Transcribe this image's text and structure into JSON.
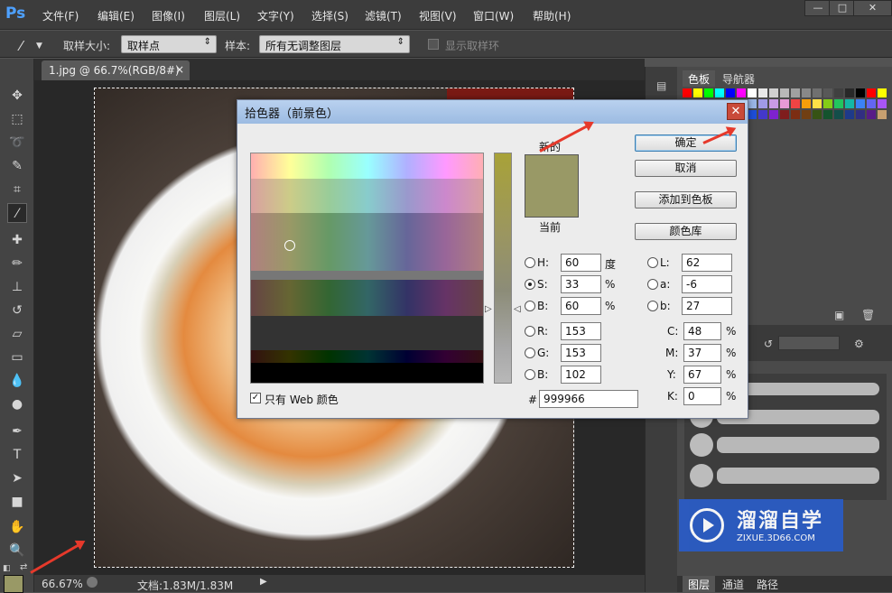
{
  "app": {
    "logo": "Ps"
  },
  "menu": [
    "文件(F)",
    "编辑(E)",
    "图像(I)",
    "图层(L)",
    "文字(Y)",
    "选择(S)",
    "滤镜(T)",
    "视图(V)",
    "窗口(W)",
    "帮助(H)"
  ],
  "options": {
    "sample_size_label": "取样大小:",
    "sample_size_value": "取样点",
    "sample_label": "样本:",
    "sample_value": "所有无调整图层",
    "show_ring_label": "显示取样环"
  },
  "document": {
    "tab_title": "1.jpg @ 66.7%(RGB/8#)",
    "close": "×"
  },
  "status": {
    "zoom": "66.67%",
    "doc_size": "文档:1.83M/1.83M"
  },
  "panels": {
    "tab_swatches": "色板",
    "tab_navigator": "导航器",
    "tab_layers": "图层",
    "tab_channels": "通道",
    "tab_paths": "路径"
  },
  "watermark": {
    "title": "溜溜自学",
    "url": "ZIXUE.3D66.COM"
  },
  "dialog": {
    "title": "拾色器（前景色）",
    "close": "✕",
    "new_label": "新的",
    "current_label": "当前",
    "ok": "确定",
    "cancel": "取消",
    "add_to_swatches": "添加到色板",
    "color_libraries": "颜色库",
    "web_only_label": "只有 Web 颜色",
    "web_only_checked": true,
    "hsb": {
      "h_label": "H:",
      "h": "60",
      "h_unit": "度",
      "s_label": "S:",
      "s": "33",
      "s_unit": "%",
      "b_label": "B:",
      "b": "60",
      "b_unit": "%"
    },
    "rgb": {
      "r_label": "R:",
      "r": "153",
      "g_label": "G:",
      "g": "153",
      "b_label": "B:",
      "b": "102"
    },
    "lab": {
      "l_label": "L:",
      "l": "62",
      "a_label": "a:",
      "a": "-6",
      "b_label": "b:",
      "b": "27"
    },
    "cmyk": {
      "c_label": "C:",
      "c": "48",
      "m_label": "M:",
      "m": "37",
      "y_label": "Y:",
      "y": "67",
      "k_label": "K:",
      "k": "0",
      "unit": "%"
    },
    "hex_label": "#",
    "hex": "999966",
    "new_color": "#999966"
  },
  "colors": {
    "foreground": "#999966",
    "background": "#ffffff",
    "accent_arrow": "#e6392b"
  }
}
